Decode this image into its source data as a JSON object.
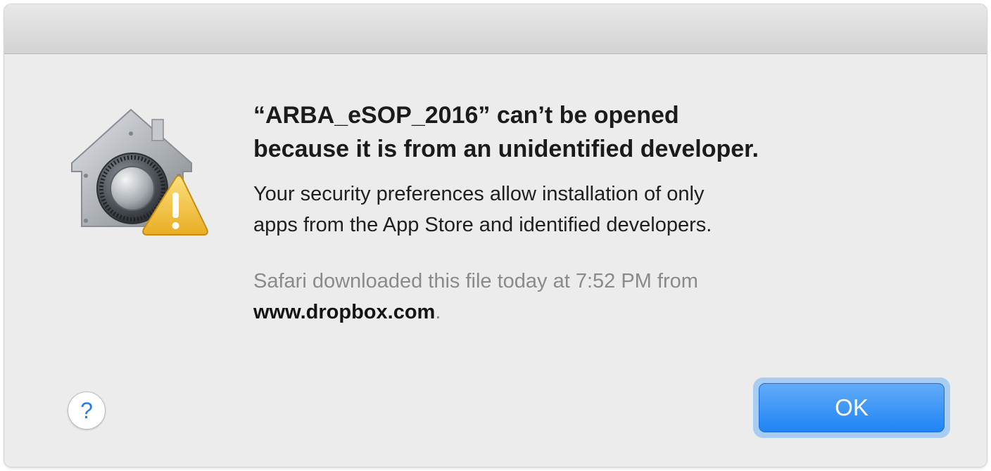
{
  "dialog": {
    "headline_lines": [
      "“ARBA_eSOP_2016” can’t be opened",
      "because it is from an unidentified developer."
    ],
    "body_lines": [
      "Your security preferences allow installation of only",
      "apps from the App Store and identified developers."
    ],
    "source_text": "Safari downloaded this file today at 7:52 PM from",
    "source_domain": "www.dropbox.com",
    "source_suffix": ".",
    "icon": "gatekeeper-warning-icon"
  },
  "buttons": {
    "help_label": "?",
    "ok_label": "OK"
  },
  "colors": {
    "accent": "#1f84f5",
    "warning": "#f2c23a",
    "dialog_background": "#ececec"
  }
}
